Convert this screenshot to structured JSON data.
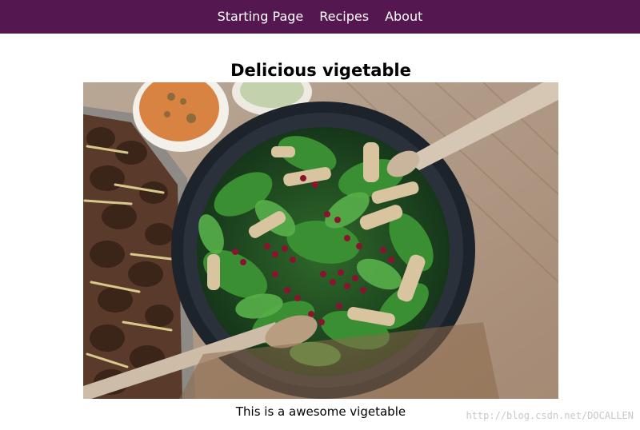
{
  "nav": {
    "items": [
      {
        "label": "Starting Page"
      },
      {
        "label": "Recipes"
      },
      {
        "label": "About"
      }
    ],
    "background": "#54174f"
  },
  "main": {
    "title": "Delicious vigetable",
    "image_alt": "salad bowl with spinach, pomegranate and chicken",
    "caption": "This is a awesome vigetable"
  },
  "watermark": "http://blog.csdn.net/DOCALLEN"
}
